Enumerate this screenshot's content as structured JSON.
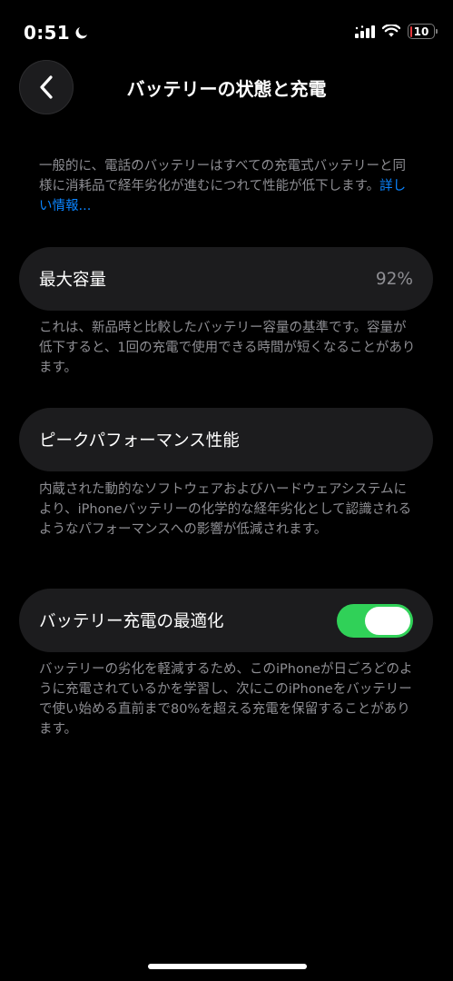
{
  "status_bar": {
    "time": "0:51",
    "battery_level": "10",
    "battery_fraction": 0.1,
    "icons": [
      "moon-icon",
      "cellular-signal-icon",
      "wifi-icon",
      "battery-icon"
    ]
  },
  "nav": {
    "title": "バッテリーの状態と充電",
    "back_icon": "chevron-left-icon"
  },
  "intro": {
    "text": "一般的に、電話のバッテリーはすべての充電式バッテリーと同様に消耗品で経年劣化が進むにつれて性能が低下します。",
    "link": "詳しい情報..."
  },
  "max_capacity": {
    "label": "最大容量",
    "value": "92%",
    "description": "これは、新品時と比較したバッテリー容量の基準です。容量が低下すると、1回の充電で使用できる時間が短くなることがあります。"
  },
  "peak_performance": {
    "label": "ピークパフォーマンス性能",
    "description": "内蔵された動的なソフトウェアおよびハードウェアシステムにより、iPhoneバッテリーの化学的な経年劣化として認識されるようなパフォーマンスへの影響が低減されます。"
  },
  "optimized_charging": {
    "label": "バッテリー充電の最適化",
    "enabled": true,
    "description": "バッテリーの劣化を軽減するため、このiPhoneが日ごろどのように充電されているかを学習し、次にこのiPhoneをバッテリーで使い始める直前まで80%を超える充電を保留することがあります。"
  },
  "colors": {
    "background": "#000000",
    "card": "#1c1c1e",
    "secondary_text": "#8e8e93",
    "link": "#0a84ff",
    "toggle_on": "#30d158",
    "battery_low": "#e5393d"
  }
}
